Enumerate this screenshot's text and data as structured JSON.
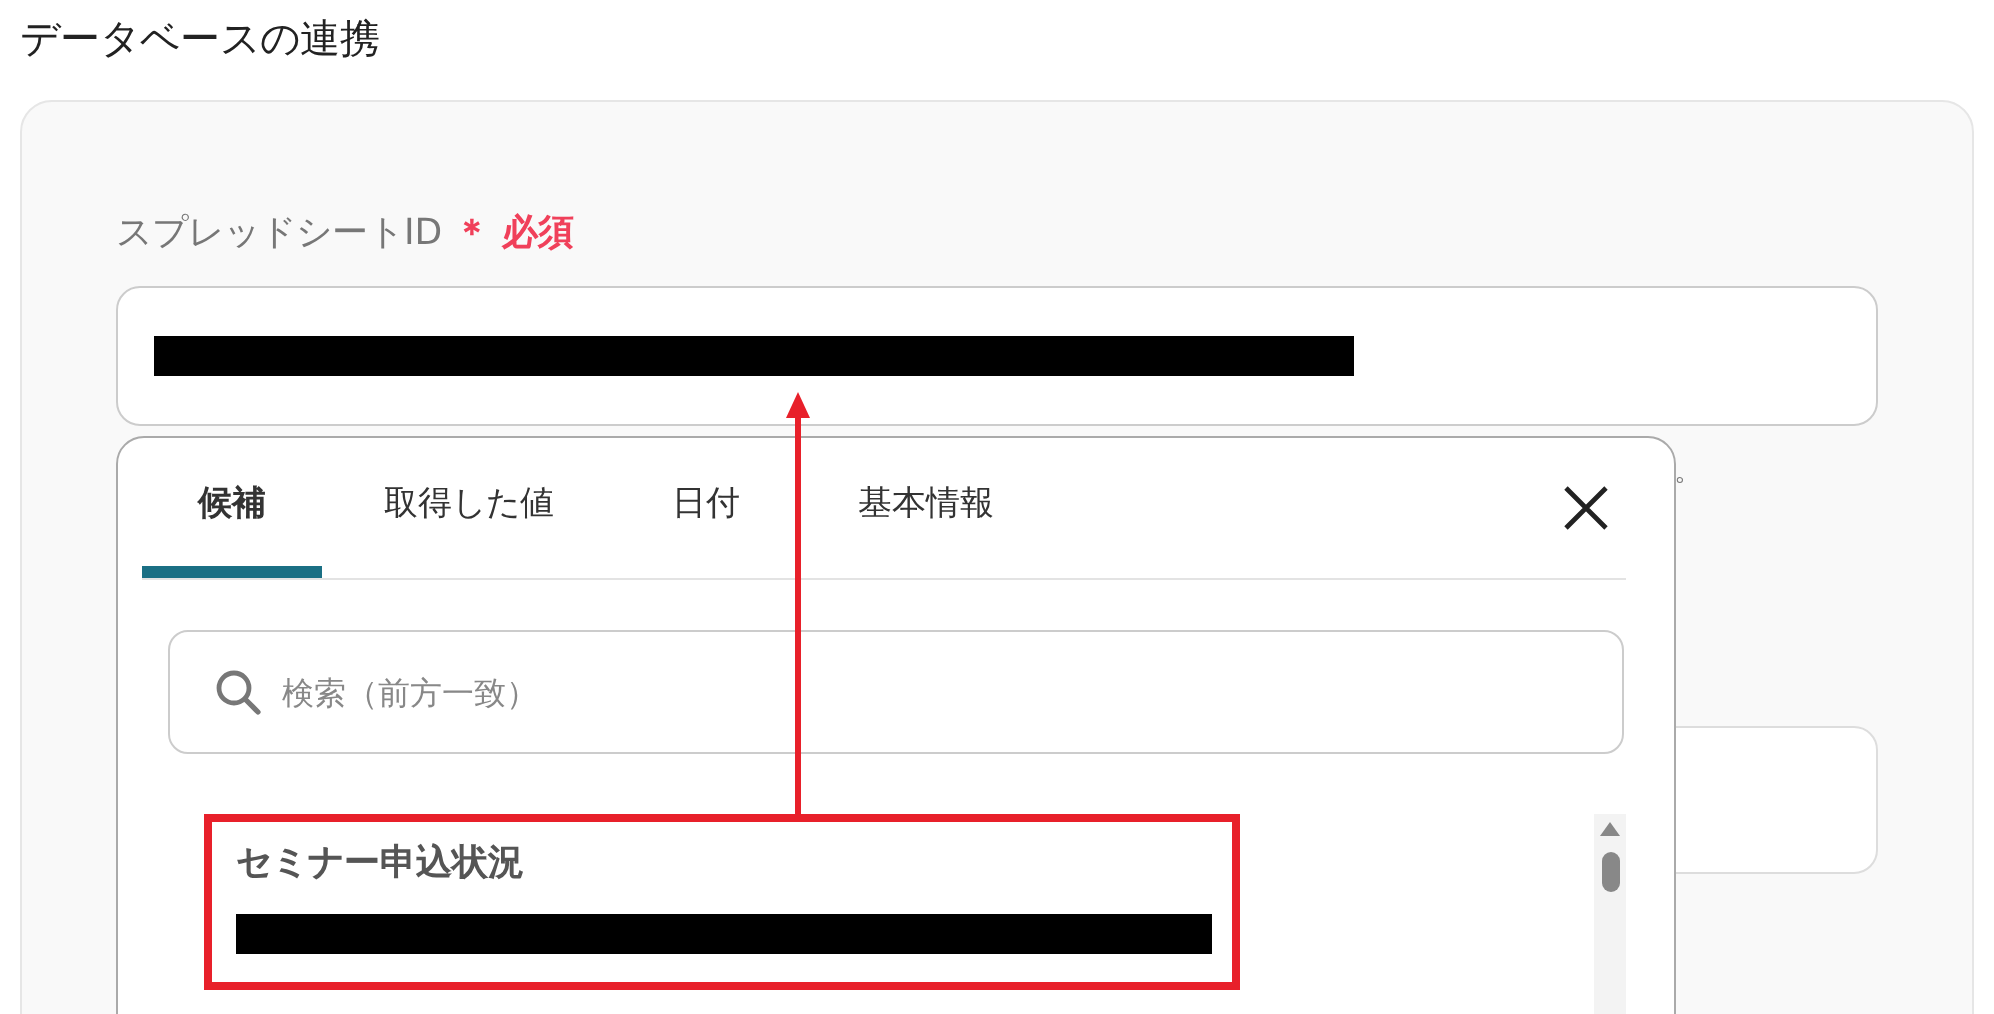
{
  "section_title": "データベースの連携",
  "field": {
    "label": "スプレッドシートID",
    "required_mark": "＊",
    "required_text": "必須"
  },
  "hint_tail": "。",
  "popup": {
    "tabs": [
      {
        "label": "候補",
        "selected": true
      },
      {
        "label": "取得した値",
        "selected": false
      },
      {
        "label": "日付",
        "selected": false
      },
      {
        "label": "基本情報",
        "selected": false
      }
    ],
    "search": {
      "placeholder": "検索（前方一致）"
    },
    "items": [
      {
        "title": "セミナー申込状況",
        "highlighted": true
      }
    ]
  }
}
